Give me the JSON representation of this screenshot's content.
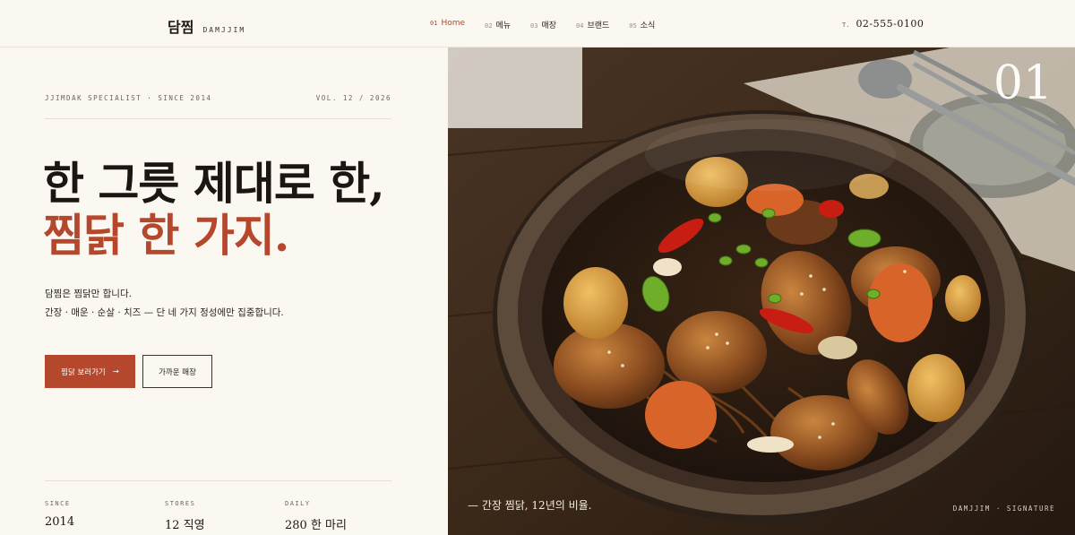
{
  "header": {
    "brand_ko": "담찜",
    "brand_en": "DAMJJIM",
    "nav": [
      {
        "num": "01",
        "label": "Home",
        "active": true
      },
      {
        "num": "02",
        "label": "메뉴",
        "active": false
      },
      {
        "num": "03",
        "label": "매장",
        "active": false
      },
      {
        "num": "04",
        "label": "브랜드",
        "active": false
      },
      {
        "num": "05",
        "label": "소식",
        "active": false
      }
    ],
    "phone_prefix": "T.",
    "phone": "02-555-0100"
  },
  "intro": {
    "tagline": "JJIMDAK SPECIALIST · SINCE 2014",
    "volume": "VOL. 12 / 2026",
    "headline_line1": "한 그릇 제대로 한,",
    "headline_line2": "찜닭 한 가지.",
    "desc_line1": "담찜은 찜닭만 합니다.",
    "desc_line2": "간장 · 매운 · 순살 · 치즈 — 단 네 가지 정성에만 집중합니다.",
    "cta_primary": "찜닭 보러가기",
    "cta_primary_arrow": "→",
    "cta_secondary": "가까운 매장"
  },
  "stats": [
    {
      "label": "SINCE",
      "value": "2014"
    },
    {
      "label": "STORES",
      "value": "12 직영"
    },
    {
      "label": "DAILY",
      "value": "280 한 마리"
    }
  ],
  "hero": {
    "number": "01",
    "caption": "— 간장 찜닭, 12년의 비율.",
    "signature": "DAMJJIM · SIGNATURE",
    "icon": "braised-chicken-photo"
  },
  "colors": {
    "accent": "#b4472c",
    "background": "#fbf7f1",
    "text": "#1f1a17"
  }
}
